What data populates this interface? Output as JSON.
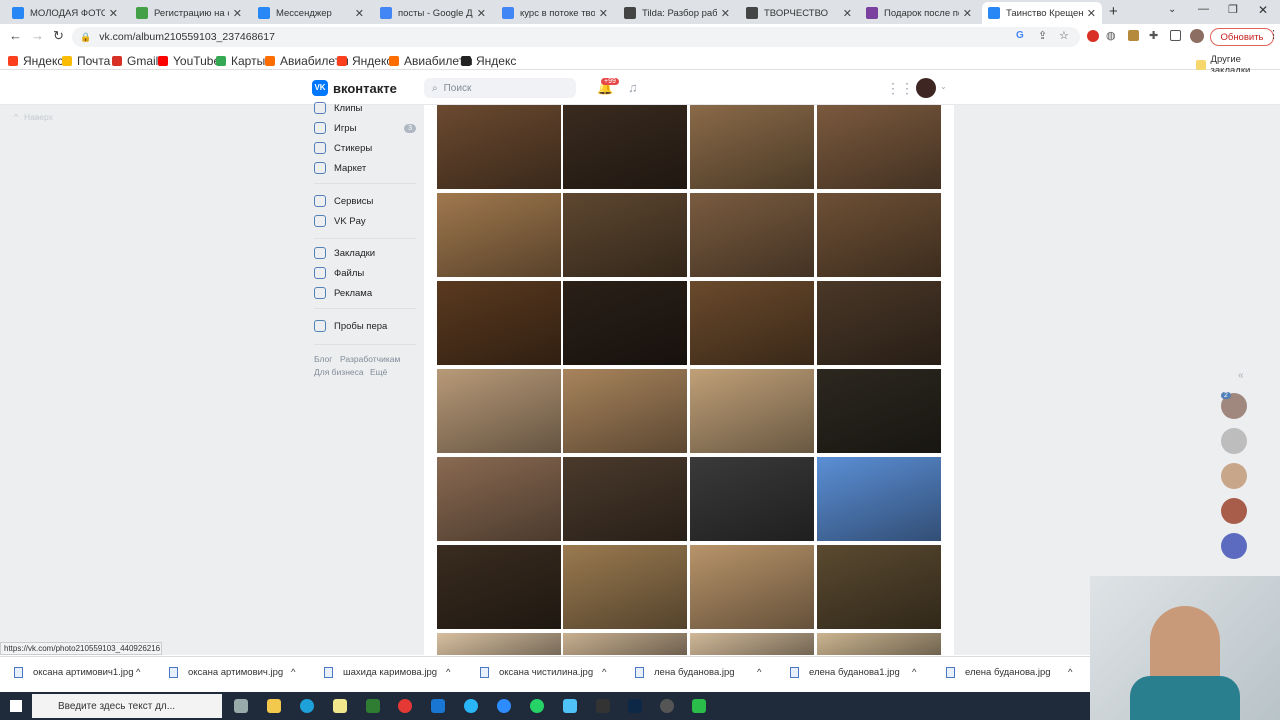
{
  "tabs": [
    {
      "title": "МОЛОДАЯ ФОТОГРА",
      "color": "#2787f5"
    },
    {
      "title": "Регистрацию на сам",
      "color": "#43a047"
    },
    {
      "title": "Мессенджер",
      "color": "#2787f5"
    },
    {
      "title": "посты - Google Доку",
      "color": "#4285f4"
    },
    {
      "title": "курс в потоке творче",
      "color": "#4285f4"
    },
    {
      "title": "Tilda: Разбор работ",
      "color": "#444444"
    },
    {
      "title": "ТВОРЧЕСТВО",
      "color": "#444444"
    },
    {
      "title": "Подарок после по",
      "color": "#7b3fa0"
    },
    {
      "title": "Таинство Крещения",
      "color": "#2787f5"
    }
  ],
  "address": {
    "url": "vk.com/album210559103_237468617",
    "update_label": "Обновить"
  },
  "bookmarks": [
    "Яндекс",
    "Почта",
    "Gmail",
    "YouTube",
    "Карты",
    "Авиабилеты",
    "Яндекс",
    "Авиабилеты",
    "Яндекс"
  ],
  "other_bookmarks": "Другие закладки",
  "vk": {
    "logo": "вконтакте",
    "search_placeholder": "Поиск",
    "notif_badge": "+99",
    "back_to_top": "Наверх",
    "menu": [
      {
        "label": "Клипы"
      },
      {
        "label": "Игры",
        "badge": "3"
      },
      {
        "label": "Стикеры"
      },
      {
        "label": "Маркет"
      },
      {
        "label": "Сервисы"
      },
      {
        "label": "VK Pay"
      },
      {
        "label": "Закладки"
      },
      {
        "label": "Файлы"
      },
      {
        "label": "Реклама"
      },
      {
        "label": "Пробы пера"
      }
    ],
    "footer": [
      "Блог",
      "Разработчикам",
      "Для бизнеса",
      "Ещё"
    ],
    "messenger_badge": "2"
  },
  "status_url": "https://vk.com/photo210559103_440926216",
  "downloads": [
    "оксана артимович1.jpg",
    "оксана артимович.jpg",
    "шахида каримова.jpg",
    "оксана чистилина.jpg",
    "лена буданова.jpg",
    "елена буданова1.jpg",
    "елена буданова.jpg"
  ],
  "taskbar": {
    "search_placeholder": "Введите здесь текст дл..."
  }
}
